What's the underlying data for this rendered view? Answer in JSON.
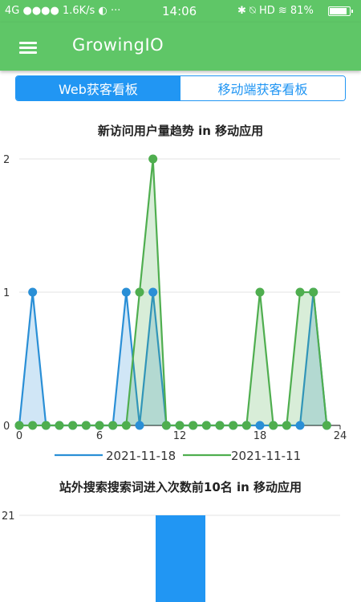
{
  "status_bar": {
    "left": "4G ●●●● 1.6K/s ◐ ···",
    "time": "14:06",
    "right": "✱ ⍉ HD ≋ 81%"
  },
  "app_bar": {
    "menu_icon": "hamburger-menu-icon",
    "title": "GrowingIO"
  },
  "tabs": [
    {
      "label": "Web获客看板",
      "active": true
    },
    {
      "label": "移动端获客看板",
      "active": false
    }
  ],
  "colors": {
    "primary_green": "#5fc667",
    "tab_blue": "#2196f3",
    "series_blue": "#2a8fd6",
    "series_green": "#4fae4f"
  },
  "chart_data": [
    {
      "type": "area",
      "title": "新访问用户量趋势   in 移动应用",
      "x": [
        0,
        1,
        2,
        3,
        4,
        5,
        6,
        7,
        8,
        9,
        10,
        11,
        12,
        13,
        14,
        15,
        16,
        17,
        18,
        19,
        20,
        21,
        22,
        23
      ],
      "xticks": [
        0,
        6,
        12,
        18,
        24
      ],
      "yticks": [
        0,
        1,
        2
      ],
      "xlim": [
        0,
        24
      ],
      "ylim": [
        0,
        2
      ],
      "grid": true,
      "legend": "bottom",
      "series": [
        {
          "name": "2021-11-18",
          "color": "#2a8fd6",
          "values": [
            0,
            1,
            0,
            0,
            0,
            0,
            0,
            0,
            1,
            0,
            1,
            0,
            0,
            0,
            0,
            0,
            0,
            0,
            0,
            0,
            0,
            0,
            1,
            0
          ]
        },
        {
          "name": "2021-11-11",
          "color": "#4fae4f",
          "values": [
            0,
            0,
            0,
            0,
            0,
            0,
            0,
            0,
            0,
            1,
            2,
            0,
            0,
            0,
            0,
            0,
            0,
            0,
            1,
            0,
            0,
            1,
            1,
            0
          ]
        }
      ]
    },
    {
      "type": "bar",
      "title": "站外搜索搜索词进入次数前10名   in 移动应用",
      "categories": [
        ""
      ],
      "values": [
        21
      ],
      "yticks": [
        21
      ],
      "ylim": [
        0,
        21
      ]
    }
  ]
}
